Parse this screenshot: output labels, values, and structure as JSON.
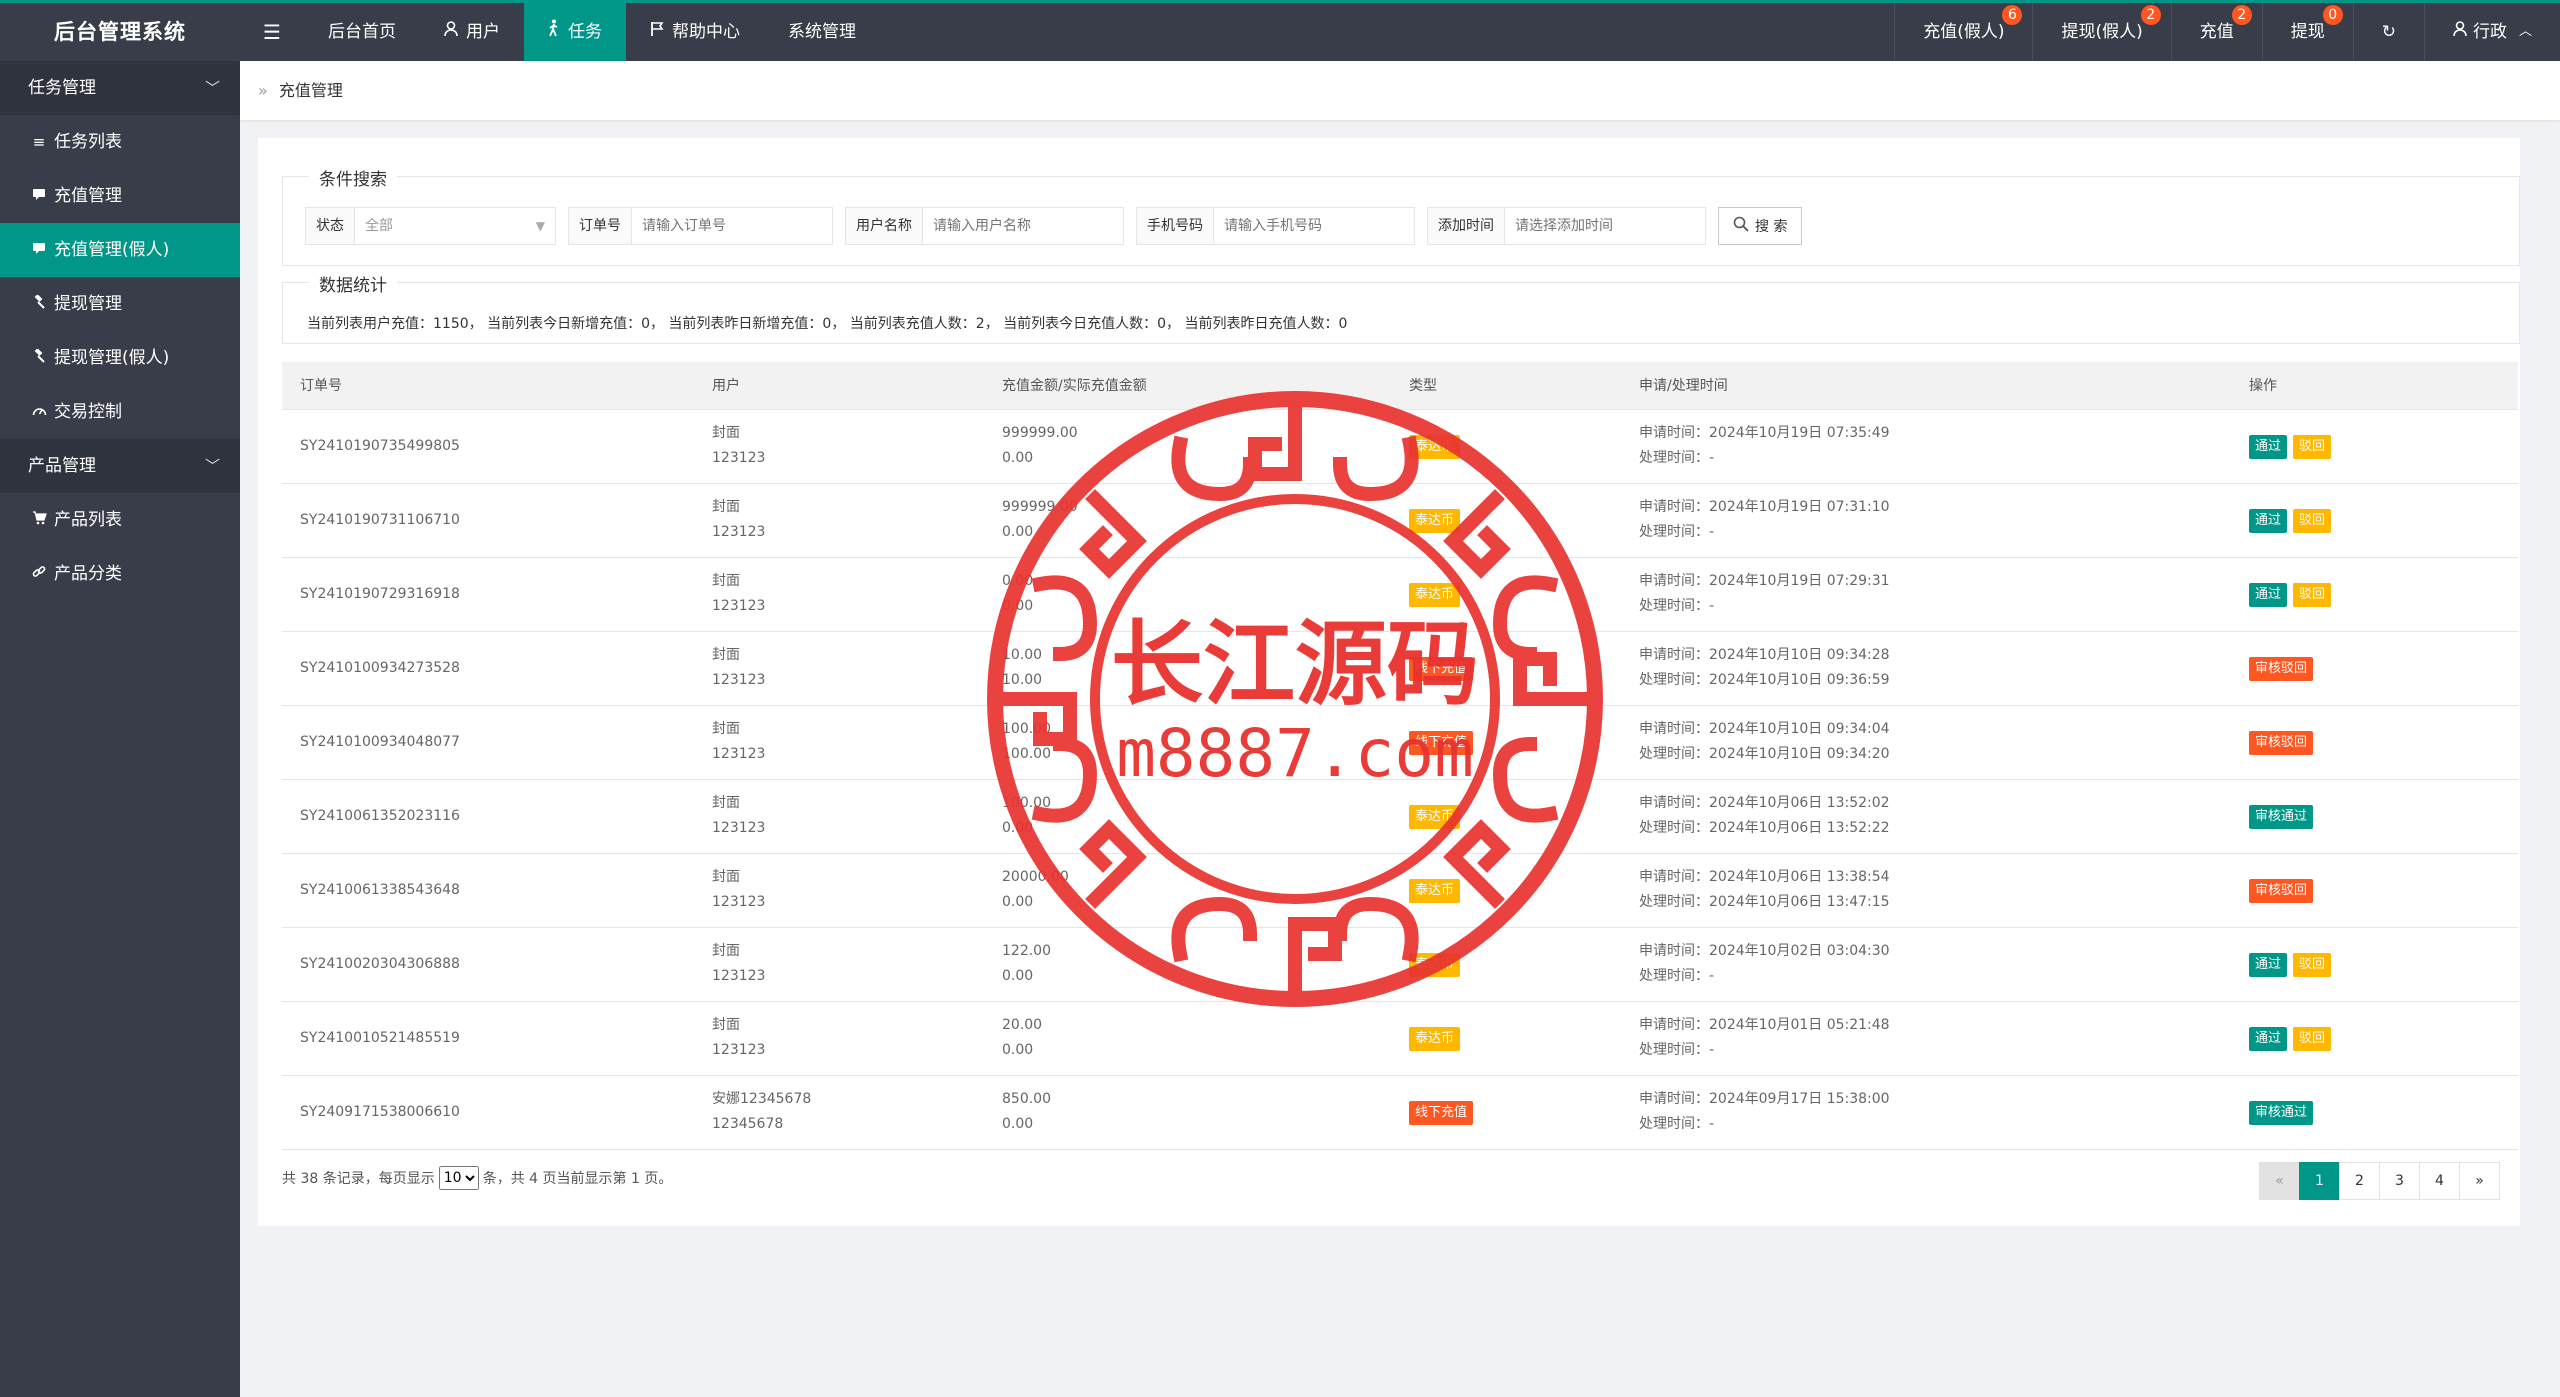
{
  "app_title": "后台管理系统",
  "topnav": {
    "menu_icon": "menu-icon",
    "items": [
      {
        "label": "后台首页"
      },
      {
        "label": "用户",
        "icon": "user-icon"
      },
      {
        "label": "任务",
        "icon": "walk-icon",
        "active": true
      },
      {
        "label": "帮助中心",
        "icon": "flag-icon"
      },
      {
        "label": "系统管理"
      }
    ]
  },
  "topright": {
    "items": [
      {
        "label": "充值(假人)",
        "badge": "6"
      },
      {
        "label": "提现(假人)",
        "badge": "2"
      },
      {
        "label": "充值",
        "badge": "2"
      },
      {
        "label": "提现",
        "badge": "0"
      }
    ],
    "refresh_icon": "refresh-icon",
    "user": {
      "label": "行政",
      "icon": "user-icon"
    }
  },
  "sidebar": {
    "groups": [
      {
        "label": "任务管理",
        "items": [
          {
            "label": "任务列表",
            "icon": "list-icon"
          },
          {
            "label": "充值管理",
            "icon": "comment-icon"
          },
          {
            "label": "充值管理(假人)",
            "icon": "comment-icon",
            "active": true
          },
          {
            "label": "提现管理",
            "icon": "gavel-icon"
          },
          {
            "label": "提现管理(假人)",
            "icon": "gavel-icon"
          },
          {
            "label": "交易控制",
            "icon": "dashboard-icon"
          }
        ]
      },
      {
        "label": "产品管理",
        "items": [
          {
            "label": "产品列表",
            "icon": "cart-icon"
          },
          {
            "label": "产品分类",
            "icon": "link-icon"
          }
        ]
      }
    ]
  },
  "breadcrumb": {
    "label": "充值管理"
  },
  "search": {
    "legend": "条件搜索",
    "status_label": "状态",
    "status_value": "全部",
    "order_label": "订单号",
    "order_placeholder": "请输入订单号",
    "username_label": "用户名称",
    "username_placeholder": "请输入用户名称",
    "phone_label": "手机号码",
    "phone_placeholder": "请输入手机号码",
    "time_label": "添加时间",
    "time_placeholder": "请选择添加时间",
    "button_label": "搜 索"
  },
  "stats": {
    "legend": "数据统计",
    "text": "当前列表用户充值：1150， 当前列表今日新增充值：0， 当前列表昨日新增充值：0， 当前列表充值人数：2， 当前列表今日充值人数：0， 当前列表昨日充值人数：0"
  },
  "table": {
    "headers": [
      "订单号",
      "用户",
      "充值金额/实际充值金额",
      "类型",
      "申请/处理时间",
      "操作"
    ],
    "rows": [
      {
        "id": "SY2410190735499805",
        "user1": "封面",
        "user2": "123123",
        "amt1": "999999.00",
        "amt2": "0.00",
        "type": "泰达币",
        "type_color": "orange",
        "apply": "申请时间：2024年10月19日 07:35:49",
        "process": "处理时间：-",
        "actions": [
          {
            "label": "通过",
            "color": "green"
          },
          {
            "label": "驳回",
            "color": "yellow"
          }
        ]
      },
      {
        "id": "SY2410190731106710",
        "user1": "封面",
        "user2": "123123",
        "amt1": "999999.00",
        "amt2": "0.00",
        "type": "泰达币",
        "type_color": "orange",
        "apply": "申请时间：2024年10月19日 07:31:10",
        "process": "处理时间：-",
        "actions": [
          {
            "label": "通过",
            "color": "green"
          },
          {
            "label": "驳回",
            "color": "yellow"
          }
        ]
      },
      {
        "id": "SY2410190729316918",
        "user1": "封面",
        "user2": "123123",
        "amt1": "0.00",
        "amt2": "0.00",
        "type": "泰达币",
        "type_color": "orange",
        "apply": "申请时间：2024年10月19日 07:29:31",
        "process": "处理时间：-",
        "actions": [
          {
            "label": "通过",
            "color": "green"
          },
          {
            "label": "驳回",
            "color": "yellow"
          }
        ]
      },
      {
        "id": "SY2410100934273528",
        "user1": "封面",
        "user2": "123123",
        "amt1": "10.00",
        "amt2": "10.00",
        "type": "线下充值",
        "type_color": "red",
        "apply": "申请时间：2024年10月10日 09:34:28",
        "process": "处理时间：2024年10月10日 09:36:59",
        "actions": [
          {
            "label": "审核驳回",
            "color": "red"
          }
        ]
      },
      {
        "id": "SY2410100934048077",
        "user1": "封面",
        "user2": "123123",
        "amt1": "100.00",
        "amt2": "100.00",
        "type": "线下充值",
        "type_color": "red",
        "apply": "申请时间：2024年10月10日 09:34:04",
        "process": "处理时间：2024年10月10日 09:34:20",
        "actions": [
          {
            "label": "审核驳回",
            "color": "red"
          }
        ]
      },
      {
        "id": "SY2410061352023116",
        "user1": "封面",
        "user2": "123123",
        "amt1": "100.00",
        "amt2": "0.00",
        "type": "泰达币",
        "type_color": "orange",
        "apply": "申请时间：2024年10月06日 13:52:02",
        "process": "处理时间：2024年10月06日 13:52:22",
        "actions": [
          {
            "label": "审核通过",
            "color": "green"
          }
        ]
      },
      {
        "id": "SY2410061338543648",
        "user1": "封面",
        "user2": "123123",
        "amt1": "20000.00",
        "amt2": "0.00",
        "type": "泰达币",
        "type_color": "orange",
        "apply": "申请时间：2024年10月06日 13:38:54",
        "process": "处理时间：2024年10月06日 13:47:15",
        "actions": [
          {
            "label": "审核驳回",
            "color": "red"
          }
        ]
      },
      {
        "id": "SY2410020304306888",
        "user1": "封面",
        "user2": "123123",
        "amt1": "122.00",
        "amt2": "0.00",
        "type": "泰达币",
        "type_color": "orange",
        "apply": "申请时间：2024年10月02日 03:04:30",
        "process": "处理时间：-",
        "actions": [
          {
            "label": "通过",
            "color": "green"
          },
          {
            "label": "驳回",
            "color": "yellow"
          }
        ]
      },
      {
        "id": "SY2410010521485519",
        "user1": "封面",
        "user2": "123123",
        "amt1": "20.00",
        "amt2": "0.00",
        "type": "泰达币",
        "type_color": "orange",
        "apply": "申请时间：2024年10月01日 05:21:48",
        "process": "处理时间：-",
        "actions": [
          {
            "label": "通过",
            "color": "green"
          },
          {
            "label": "驳回",
            "color": "yellow"
          }
        ]
      },
      {
        "id": "SY2409171538006610",
        "user1": "安娜12345678",
        "user2": "12345678",
        "amt1": "850.00",
        "amt2": "0.00",
        "type": "线下充值",
        "type_color": "red",
        "apply": "申请时间：2024年09月17日 15:38:00",
        "process": "处理时间：-",
        "actions": [
          {
            "label": "审核通过",
            "color": "green"
          }
        ]
      }
    ]
  },
  "pagination": {
    "text_before": "共 38 条记录，每页显示",
    "per_page": "10",
    "text_after": "条，共 4 页当前显示第 1 页。",
    "prev": "«",
    "pages": [
      "1",
      "2",
      "3",
      "4"
    ],
    "current": "1",
    "next": "»"
  },
  "watermark": {
    "title": "长江源码",
    "url": "m8887.com",
    "color": "#e8322f"
  }
}
